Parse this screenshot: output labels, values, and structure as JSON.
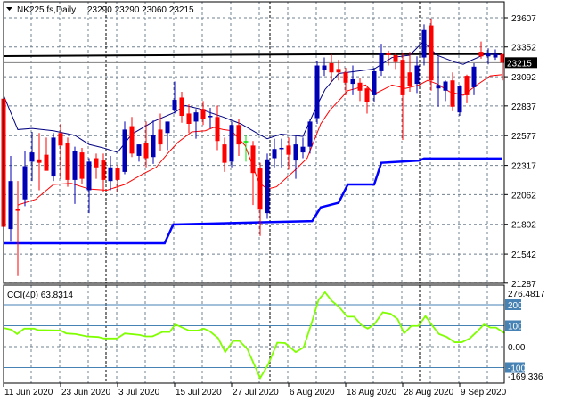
{
  "header": {
    "symbol": "NK225.fs,Daily",
    "ohlc": "23290 23290 23060 23215",
    "menu_icon": "triangle-down-icon"
  },
  "colors": {
    "bull": "#0000b4",
    "bear": "#ff0000",
    "doji": "#00e000",
    "upper_ma": "#000080",
    "lower_ma": "#ff0000",
    "support": "#0000ff",
    "resistance": "#000000",
    "cci": "#80ff00",
    "cci_level": "#4682b4",
    "grid": "#708090"
  },
  "price_axis": {
    "ticks": [
      "23607",
      "23352",
      "23092",
      "22837",
      "22577",
      "22317",
      "22062",
      "21802",
      "21542",
      "21287"
    ],
    "current": "23215"
  },
  "cci": {
    "label": "CCI(40) 63.8314",
    "max_label": "276.4817",
    "min_label": "-169.336",
    "levels": [
      "200",
      "100",
      "0.00",
      "-100"
    ]
  },
  "date_axis": {
    "labels": [
      "11 Jun 2020",
      "23 Jun 2020",
      "3 Jul 2020",
      "15 Jul 2020",
      "27 Jul 2020",
      "6 Aug 2020",
      "18 Aug 2020",
      "28 Aug 2020",
      "9 Sep 2020"
    ]
  },
  "chart_data": {
    "type": "candlestick",
    "title": "NK225.fs,Daily",
    "ylim": [
      21287,
      23607
    ],
    "current_price": 23215,
    "ohlc": [
      [
        22900,
        23000,
        21700,
        21780
      ],
      [
        21760,
        22400,
        21650,
        22180
      ],
      [
        21940,
        22180,
        21350,
        21920
      ],
      [
        22020,
        22440,
        21960,
        22310
      ],
      [
        22350,
        22610,
        22180,
        22430
      ],
      [
        22370,
        22600,
        22100,
        22340
      ],
      [
        22410,
        22560,
        22300,
        22270
      ],
      [
        22220,
        22600,
        22180,
        22560
      ],
      [
        22600,
        22680,
        22200,
        22490
      ],
      [
        22510,
        22560,
        22130,
        22190
      ],
      [
        22190,
        22480,
        21980,
        22440
      ],
      [
        22430,
        22470,
        22150,
        22200
      ],
      [
        22100,
        22380,
        21900,
        22350
      ],
      [
        22380,
        22420,
        22200,
        22300
      ],
      [
        22360,
        22420,
        22080,
        22190
      ],
      [
        22180,
        22400,
        22100,
        22300
      ],
      [
        22290,
        22320,
        22080,
        22190
      ],
      [
        22260,
        22700,
        22240,
        22630
      ],
      [
        22660,
        22740,
        22390,
        22420
      ],
      [
        22400,
        22500,
        22350,
        22500
      ],
      [
        22510,
        22700,
        22300,
        22380
      ],
      [
        22390,
        22710,
        22330,
        22580
      ],
      [
        22630,
        22770,
        22440,
        22500
      ],
      [
        22600,
        22700,
        22450,
        22700
      ],
      [
        22800,
        23050,
        22770,
        22890
      ],
      [
        22910,
        22960,
        22690,
        22750
      ],
      [
        22770,
        22850,
        22600,
        22680
      ],
      [
        22700,
        22810,
        22550,
        22780
      ],
      [
        22810,
        22880,
        22670,
        22720
      ],
      [
        22740,
        22820,
        22640,
        22750
      ],
      [
        22740,
        22840,
        22450,
        22530
      ],
      [
        22500,
        22560,
        22260,
        22340
      ],
      [
        22350,
        22700,
        22300,
        22670
      ],
      [
        22670,
        22720,
        22400,
        22500
      ],
      [
        22530,
        22580,
        22350,
        22530
      ],
      [
        22490,
        22530,
        21970,
        22250
      ],
      [
        22290,
        22340,
        21700,
        21930
      ],
      [
        21900,
        22420,
        21850,
        22370
      ],
      [
        22380,
        22550,
        22300,
        22460
      ],
      [
        22460,
        22550,
        22300,
        22470
      ],
      [
        22490,
        22560,
        22280,
        22410
      ],
      [
        22360,
        22580,
        22200,
        22500
      ],
      [
        22430,
        22560,
        22380,
        22480
      ],
      [
        22480,
        22720,
        22420,
        22700
      ],
      [
        22730,
        23230,
        22680,
        23190
      ],
      [
        23150,
        23260,
        23100,
        23190
      ],
      [
        23210,
        23290,
        23050,
        23130
      ],
      [
        23160,
        23240,
        23060,
        23130
      ],
      [
        23130,
        23170,
        22930,
        23040
      ],
      [
        23030,
        23190,
        22930,
        23070
      ],
      [
        23040,
        23080,
        22880,
        22970
      ],
      [
        22990,
        23000,
        22770,
        22870
      ],
      [
        22930,
        23170,
        22870,
        23140
      ],
      [
        23140,
        23380,
        23100,
        23300
      ],
      [
        23300,
        23320,
        23190,
        23280
      ],
      [
        23280,
        23300,
        23160,
        23220
      ],
      [
        23240,
        23300,
        22540,
        22930
      ],
      [
        23130,
        23310,
        22960,
        23010
      ],
      [
        23030,
        23270,
        22950,
        23190
      ],
      [
        23260,
        23550,
        23190,
        23500
      ],
      [
        23540,
        23600,
        22970,
        23060
      ],
      [
        22990,
        23270,
        22830,
        23020
      ],
      [
        22970,
        23060,
        22880,
        23050
      ],
      [
        23060,
        23130,
        22790,
        22830
      ],
      [
        22780,
        23020,
        22750,
        23010
      ],
      [
        23100,
        23110,
        22860,
        22930
      ],
      [
        23000,
        23210,
        22930,
        23180
      ],
      [
        23310,
        23400,
        23250,
        23270
      ],
      [
        23270,
        23340,
        23200,
        23300
      ],
      [
        23260,
        23330,
        23240,
        23290
      ],
      [
        23290,
        23290,
        23060,
        23215
      ]
    ],
    "upper_ma": [
      [
        0,
        22930
      ],
      [
        2,
        22630
      ],
      [
        4,
        22640
      ],
      [
        7,
        22620
      ],
      [
        10,
        22580
      ],
      [
        12,
        22500
      ],
      [
        14,
        22470
      ],
      [
        16,
        22430
      ],
      [
        18,
        22590
      ],
      [
        21,
        22700
      ],
      [
        24,
        22780
      ],
      [
        25.5,
        22840
      ],
      [
        27.6,
        22810
      ],
      [
        28.9,
        22780
      ],
      [
        30.8,
        22740
      ],
      [
        33.3,
        22680
      ],
      [
        35.8,
        22590
      ],
      [
        37,
        22550
      ],
      [
        38.9,
        22590
      ],
      [
        42,
        22570
      ],
      [
        43.9,
        22830
      ],
      [
        45.1,
        22980
      ],
      [
        47,
        23120
      ],
      [
        49.5,
        23140
      ],
      [
        52,
        23160
      ],
      [
        54.5,
        23260
      ],
      [
        57,
        23280
      ],
      [
        58.9,
        23400
      ],
      [
        60.8,
        23280
      ],
      [
        63.3,
        23220
      ],
      [
        64.5,
        23200
      ],
      [
        65.8,
        23240
      ],
      [
        67.6,
        23290
      ],
      [
        68.9,
        23290
      ],
      [
        70,
        23280
      ]
    ],
    "lower_ma": [
      [
        2,
        21970
      ],
      [
        4.5,
        22020
      ],
      [
        7,
        22150
      ],
      [
        9.5,
        22160
      ],
      [
        12,
        22110
      ],
      [
        14.5,
        22100
      ],
      [
        17,
        22150
      ],
      [
        19.5,
        22240
      ],
      [
        21.4,
        22300
      ],
      [
        23.3,
        22440
      ],
      [
        24.5,
        22520
      ],
      [
        26.4,
        22610
      ],
      [
        28.3,
        22620
      ],
      [
        29.5,
        22650
      ],
      [
        30.8,
        22630
      ],
      [
        32,
        22620
      ],
      [
        33.9,
        22490
      ],
      [
        35.8,
        22170
      ],
      [
        37,
        22110
      ],
      [
        38.3,
        22130
      ],
      [
        40.8,
        22270
      ],
      [
        42.6,
        22380
      ],
      [
        44.5,
        22680
      ],
      [
        45.8,
        22800
      ],
      [
        47,
        22880
      ],
      [
        48.3,
        22970
      ],
      [
        49.5,
        22990
      ],
      [
        50.8,
        23020
      ],
      [
        52,
        22940
      ],
      [
        53.3,
        22980
      ],
      [
        54.5,
        23020
      ],
      [
        56.4,
        22990
      ],
      [
        58.3,
        23020
      ],
      [
        59.5,
        23060
      ],
      [
        60.8,
        23030
      ],
      [
        62.6,
        22960
      ],
      [
        64.5,
        22930
      ],
      [
        66.4,
        23020
      ],
      [
        68.3,
        23100
      ],
      [
        70,
        23110
      ]
    ],
    "support_line": [
      [
        0,
        21636
      ],
      [
        22.6,
        21636
      ],
      [
        23.8,
        21800
      ],
      [
        43.3,
        21830
      ],
      [
        44.5,
        21950
      ],
      [
        47,
        21990
      ],
      [
        48.3,
        22150
      ],
      [
        52,
        22150
      ],
      [
        53,
        22340
      ],
      [
        58.3,
        22360
      ],
      [
        59,
        22377
      ],
      [
        70,
        22377
      ]
    ],
    "resistance_line": [
      [
        0,
        23272
      ],
      [
        22,
        23280
      ],
      [
        44,
        23288
      ],
      [
        70,
        23290
      ]
    ],
    "cci_values": [
      [
        0,
        89
      ],
      [
        1.1,
        81
      ],
      [
        1.9,
        60
      ],
      [
        2.9,
        86
      ],
      [
        4.3,
        86
      ],
      [
        4.8,
        79
      ],
      [
        8,
        77
      ],
      [
        8.8,
        63
      ],
      [
        10.1,
        60
      ],
      [
        11.7,
        49
      ],
      [
        13.3,
        46
      ],
      [
        14.1,
        39
      ],
      [
        15.9,
        39
      ],
      [
        17,
        63
      ],
      [
        19.1,
        56
      ],
      [
        19.9,
        49
      ],
      [
        20.9,
        49
      ],
      [
        22.3,
        70
      ],
      [
        23.3,
        70
      ],
      [
        24.1,
        106
      ],
      [
        26,
        77
      ],
      [
        27.3,
        77
      ],
      [
        28.1,
        86
      ],
      [
        28.9,
        74
      ],
      [
        30.1,
        41
      ],
      [
        31.1,
        -26
      ],
      [
        32.2,
        27
      ],
      [
        33.1,
        27
      ],
      [
        34.2,
        -11
      ],
      [
        36,
        -150
      ],
      [
        37.1,
        -87
      ],
      [
        38.4,
        19
      ],
      [
        39.5,
        17
      ],
      [
        41,
        -26
      ],
      [
        42.1,
        -4
      ],
      [
        43.2,
        110
      ],
      [
        44.2,
        224
      ],
      [
        45.1,
        260
      ],
      [
        46.1,
        217
      ],
      [
        47.1,
        189
      ],
      [
        48.2,
        143
      ],
      [
        49.2,
        143
      ],
      [
        50.2,
        103
      ],
      [
        51.1,
        86
      ],
      [
        52,
        106
      ],
      [
        53.2,
        164
      ],
      [
        54.3,
        157
      ],
      [
        55.3,
        131
      ],
      [
        56.2,
        63
      ],
      [
        57.2,
        99
      ],
      [
        58.2,
        99
      ],
      [
        59.2,
        146
      ],
      [
        60.1,
        103
      ],
      [
        61.1,
        60
      ],
      [
        62.2,
        46
      ],
      [
        63.3,
        21
      ],
      [
        64.3,
        21
      ],
      [
        65.4,
        39
      ],
      [
        66.4,
        71
      ],
      [
        67.4,
        106
      ],
      [
        68.3,
        91
      ],
      [
        69.1,
        91
      ],
      [
        70.3,
        64
      ]
    ],
    "cci_levels": [
      200,
      100,
      0,
      -100
    ],
    "cci_range": [
      -169.336,
      276.4817
    ],
    "x_tick_bar_index": [
      0,
      8,
      16,
      24,
      32,
      40,
      48,
      56,
      64
    ],
    "period_separators_bar_index": [
      14,
      37,
      58
    ]
  }
}
